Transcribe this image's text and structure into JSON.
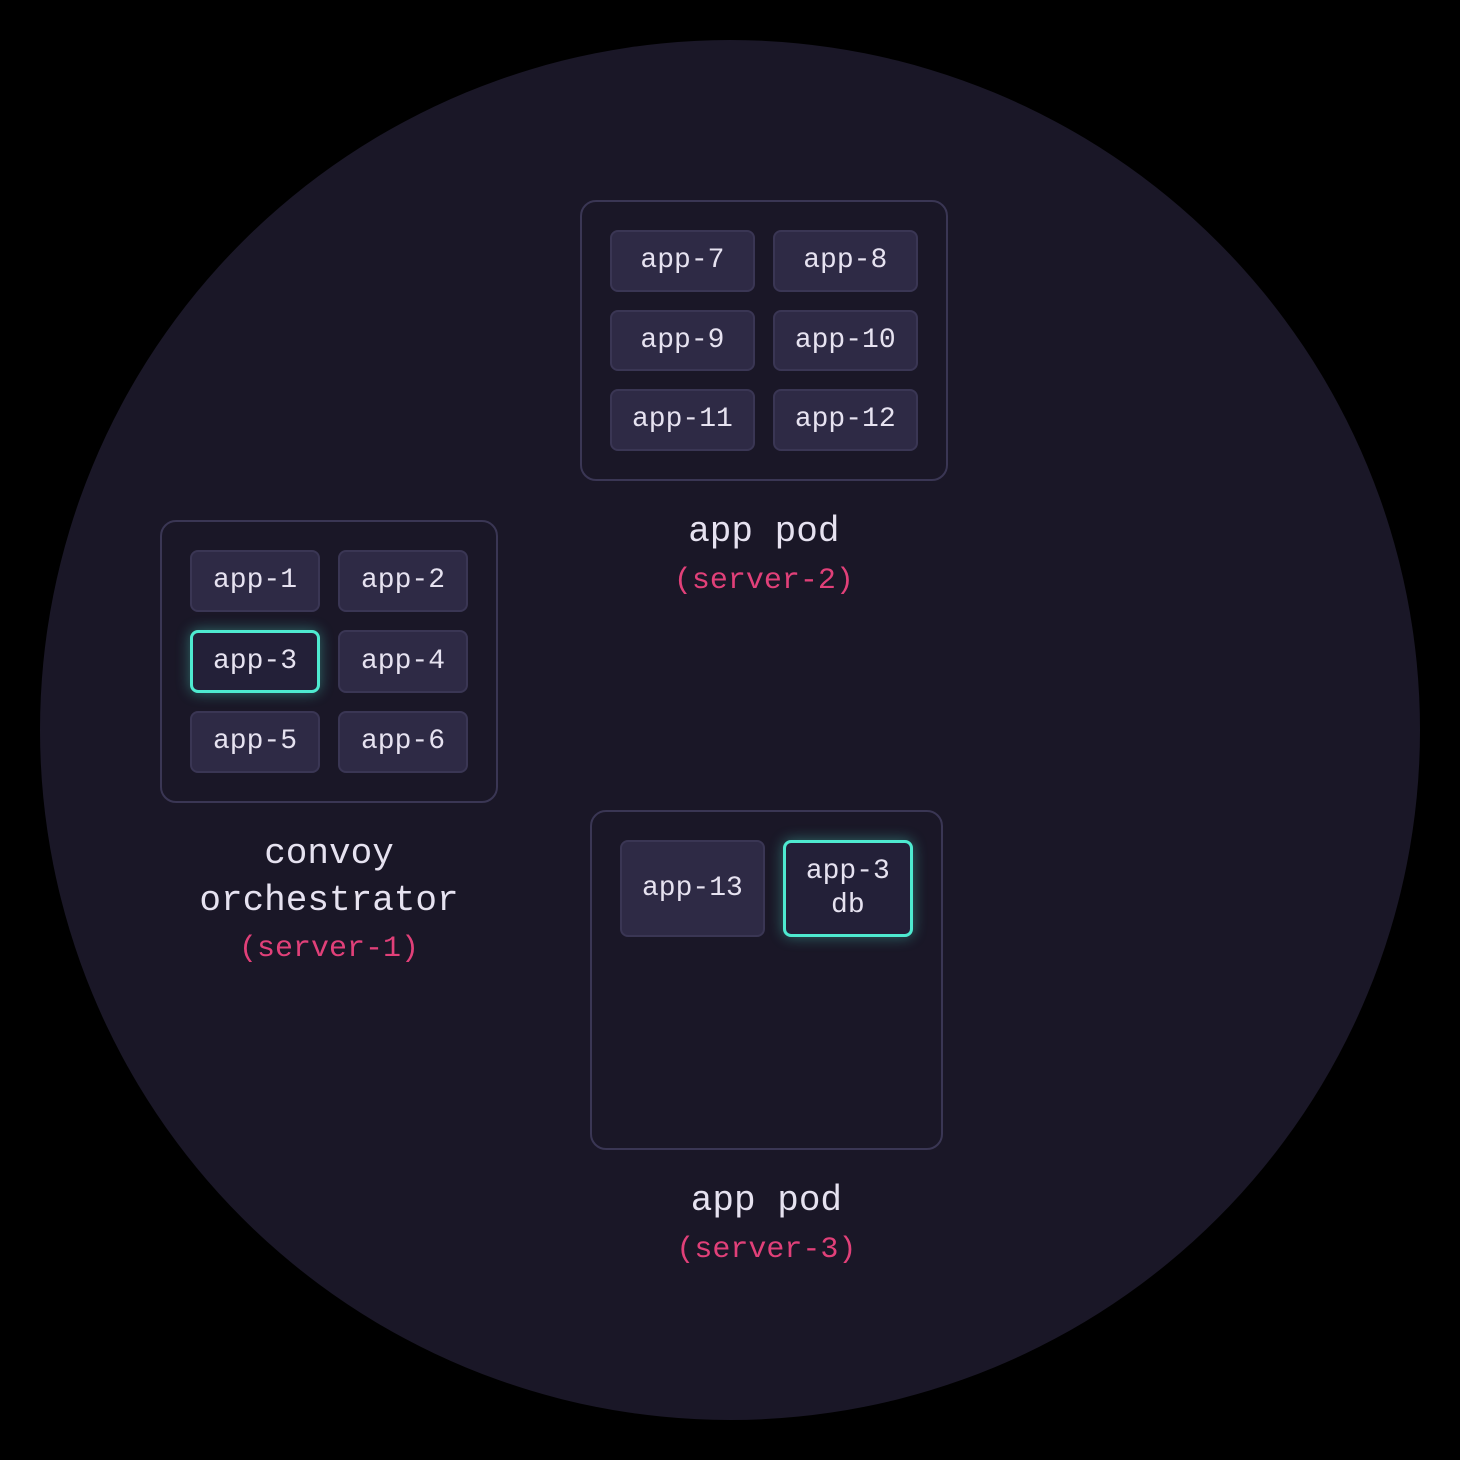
{
  "colors": {
    "background": "#000000",
    "circle": "#1a1727",
    "tile_bg": "#2e2a45",
    "tile_border": "#3a3654",
    "highlight_border": "#4eead0",
    "text": "#e6e2f0",
    "server_text": "#e14079"
  },
  "pods": {
    "pod1": {
      "title": "convoy\norchestrator",
      "server": "(server-1)",
      "apps": {
        "a1": "app-1",
        "a2": "app-2",
        "a3": "app-3",
        "a4": "app-4",
        "a5": "app-5",
        "a6": "app-6"
      },
      "highlighted": "app-3"
    },
    "pod2": {
      "title": "app pod",
      "server": "(server-2)",
      "apps": {
        "a7": "app-7",
        "a8": "app-8",
        "a9": "app-9",
        "a10": "app-10",
        "a11": "app-11",
        "a12": "app-12"
      }
    },
    "pod3": {
      "title": "app pod",
      "server": "(server-3)",
      "apps": {
        "a13": "app-13",
        "a14_line1": "app-3",
        "a14_line2": "db"
      },
      "highlighted": "app-3 db"
    }
  }
}
